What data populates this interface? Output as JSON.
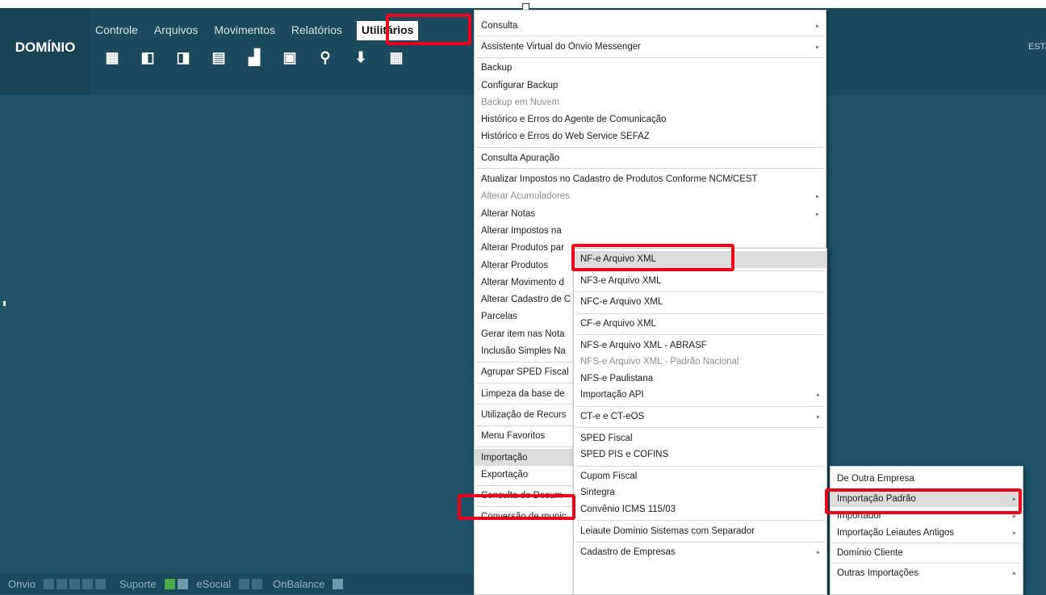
{
  "app": {
    "logo": "DOMÍNIO",
    "right_label": "ESTA"
  },
  "menubar": [
    {
      "label": "Controle"
    },
    {
      "label": "Arquivos"
    },
    {
      "label": "Movimentos"
    },
    {
      "label": "Relatórios"
    },
    {
      "label": "Utilitários",
      "active": true
    }
  ],
  "toolbar": [
    {
      "icon": "building-icon",
      "glyph": "▦"
    },
    {
      "icon": "company-open-icon",
      "glyph": "◧"
    },
    {
      "icon": "company-next-icon",
      "glyph": "◨"
    },
    {
      "icon": "report-icon",
      "glyph": "▤"
    },
    {
      "icon": "printer-icon",
      "glyph": "▟"
    },
    {
      "icon": "calculator-icon",
      "glyph": "▣"
    },
    {
      "icon": "search-icon",
      "glyph": "⚲"
    },
    {
      "icon": "download-icon",
      "glyph": "⬇"
    },
    {
      "icon": "calendar-icon",
      "glyph": "▦"
    }
  ],
  "statusbar": {
    "onvio": "Onvio",
    "suporte": "Suporte",
    "esocial": "eSocial",
    "onbalance": "OnBalance"
  },
  "menu_main": [
    {
      "label": "Consulta",
      "arrow": true
    },
    {
      "sep": true
    },
    {
      "label": "Assistente Virtual do Onvio Messenger",
      "arrow": true
    },
    {
      "sep": true
    },
    {
      "label": "Backup"
    },
    {
      "label": "Configurar Backup"
    },
    {
      "label": "Backup em Nuvem",
      "disabled": true
    },
    {
      "label": "Histórico e Erros do Agente de Comunicação"
    },
    {
      "label": "Histórico e Erros do Web Service SEFAZ"
    },
    {
      "sep": true
    },
    {
      "label": "Consulta Apuração"
    },
    {
      "sep": true
    },
    {
      "label": "Atualizar Impostos no Cadastro de Produtos Conforme NCM/CEST"
    },
    {
      "label": "Alterar Acumuladores",
      "disabled": true,
      "arrow": true
    },
    {
      "label": "Alterar Notas",
      "arrow": true
    },
    {
      "label": "Alterar Impostos na"
    },
    {
      "label": "Alterar Produtos par"
    },
    {
      "label": "Alterar Produtos"
    },
    {
      "label": "Alterar Movimento d"
    },
    {
      "label": "Alterar Cadastro de C"
    },
    {
      "label": "Parcelas"
    },
    {
      "label": "Gerar item nas Nota"
    },
    {
      "label": "Inclusão Simples Na"
    },
    {
      "sep": true
    },
    {
      "label": "Agrupar SPED Fiscal"
    },
    {
      "sep": true
    },
    {
      "label": "Limpeza da base de"
    },
    {
      "sep": true
    },
    {
      "label": "Utilização de Recurs"
    },
    {
      "sep": true
    },
    {
      "label": "Menu Favoritos"
    },
    {
      "sep": true
    },
    {
      "label": "Importação",
      "selected": true
    },
    {
      "label": "Exportação"
    },
    {
      "sep": true
    },
    {
      "label": "Consulta de Docum"
    },
    {
      "sep": true
    },
    {
      "label": "Conversão de munic"
    }
  ],
  "menu_sub1": [
    {
      "label": "NF-e Arquivo XML",
      "selected": true
    },
    {
      "sep": true
    },
    {
      "label": "NF3-e Arquivo XML"
    },
    {
      "sep": true
    },
    {
      "label": "NFC-e Arquivo XML"
    },
    {
      "sep": true
    },
    {
      "label": "CF-e Arquivo XML"
    },
    {
      "sep": true
    },
    {
      "label": "NFS-e Arquivo XML - ABRASF"
    },
    {
      "label": "NFS-e Arquivo XML - Padrão Nacional",
      "disabled": true
    },
    {
      "label": "NFS-e Paulistana"
    },
    {
      "label": "Importação API",
      "arrow": true
    },
    {
      "sep": true
    },
    {
      "label": "CT-e e CT-eOS",
      "arrow": true
    },
    {
      "sep": true
    },
    {
      "label": "SPED Fiscal"
    },
    {
      "label": "SPED PIS e COFINS"
    },
    {
      "sep": true
    },
    {
      "label": "Cupom Fiscal"
    },
    {
      "label": "Sintegra"
    },
    {
      "label": "Convênio ICMS 115/03"
    },
    {
      "sep": true
    },
    {
      "label": "Leiaute Domínio Sistemas com Separador"
    },
    {
      "sep": true
    },
    {
      "label": "Cadastro de Empresas",
      "arrow": true
    }
  ],
  "menu_sub2": [
    {
      "label": "De Outra Empresa"
    },
    {
      "sep": true
    },
    {
      "label": "Importação Padrão",
      "arrow": true,
      "selected": true
    },
    {
      "label": "Importador",
      "arrow": true
    },
    {
      "label": "Importação Leiautes Antigos",
      "arrow": true
    },
    {
      "sep": true
    },
    {
      "label": "Domínio Cliente"
    },
    {
      "sep": true
    },
    {
      "label": "Outras Importações",
      "arrow": true
    }
  ]
}
